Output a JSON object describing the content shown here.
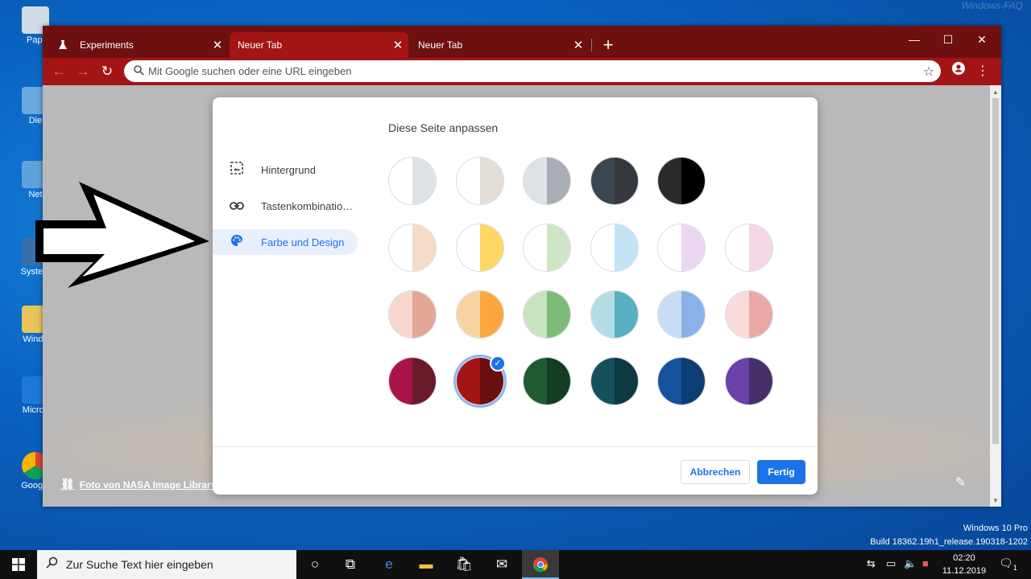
{
  "desktop": {
    "watermark": "Windows-FAQ",
    "icons": [
      "Papi",
      "Die",
      "Net",
      "System",
      "Windo",
      "Micros",
      "Google"
    ],
    "windows_info": {
      "edition": "Windows 10 Pro",
      "build": "Build 18362.19h1_release.190318-1202"
    }
  },
  "browser": {
    "tabs": [
      {
        "label": "Experiments",
        "icon": "flask-icon"
      },
      {
        "label": "Neuer Tab",
        "active": true
      },
      {
        "label": "Neuer Tab"
      }
    ],
    "close_glyph": "✕",
    "new_tab_glyph": "+",
    "window_controls": {
      "minimize": "—",
      "maximize": "☐",
      "close": "✕"
    },
    "toolbar": {
      "back": "←",
      "forward": "→",
      "reload": "↻",
      "omnibox_placeholder": "Mit Google suchen oder eine URL eingeben",
      "bookmark_star": "☆",
      "menu": "⋮"
    },
    "theme_color": "#a31515",
    "frame_color": "#6e0f10"
  },
  "ntp": {
    "photo_credit": "Foto von NASA Image Library",
    "link_glyph": "⛓",
    "edit_glyph": "✎"
  },
  "dialog": {
    "title": "Diese Seite anpassen",
    "nav": [
      {
        "label": "Hintergrund",
        "icon": "background-image-icon",
        "glyph": "▣"
      },
      {
        "label": "Tastenkombinatio…",
        "icon": "link-icon",
        "glyph": "⛓"
      },
      {
        "label": "Farbe und Design",
        "icon": "palette-icon",
        "glyph": "●",
        "active": true
      }
    ],
    "swatch_rows": [
      [
        [
          "#ffffff",
          "#dee1e6"
        ],
        [
          "#ffffff",
          "#e3ddd8"
        ],
        [
          "#dee1e6",
          "#a8acb3"
        ],
        [
          "#3c4650",
          "#35393f"
        ],
        [
          "#2a2a2a",
          "#000000"
        ]
      ],
      [
        [
          "#ffffff",
          "#f4dcc8"
        ],
        [
          "#ffffff",
          "#fdd663"
        ],
        [
          "#ffffff",
          "#cee6c6"
        ],
        [
          "#ffffff",
          "#c2e4f4"
        ],
        [
          "#ffffff",
          "#ecd6f4"
        ],
        [
          "#ffffff",
          "#f4d6e4"
        ]
      ],
      [
        [
          "#f6d6cd",
          "#e3a796"
        ],
        [
          "#f8d4a4",
          "#fba73d"
        ],
        [
          "#c8e3c0",
          "#7cbc78"
        ],
        [
          "#b2dde4",
          "#57b1c1"
        ],
        [
          "#c8dcf4",
          "#88b2e8"
        ],
        [
          "#f8dcdc",
          "#eca8a6"
        ]
      ],
      [
        [
          "#a8134a",
          "#6a1b2a"
        ],
        [
          "#a31515",
          "#6b0f10"
        ],
        [
          "#1f5a30",
          "#123d20"
        ],
        [
          "#15505e",
          "#0c3a40"
        ],
        [
          "#16519c",
          "#0c3d75"
        ],
        [
          "#6b40a8",
          "#46306a"
        ]
      ]
    ],
    "selected": [
      3,
      1
    ],
    "check_glyph": "✓",
    "cancel_label": "Abbrechen",
    "done_label": "Fertig"
  },
  "taskbar": {
    "search_placeholder": "Zur Suche Text hier eingeben",
    "clock_time": "02:20",
    "clock_date": "11.12.2019",
    "notification_count": "1"
  }
}
